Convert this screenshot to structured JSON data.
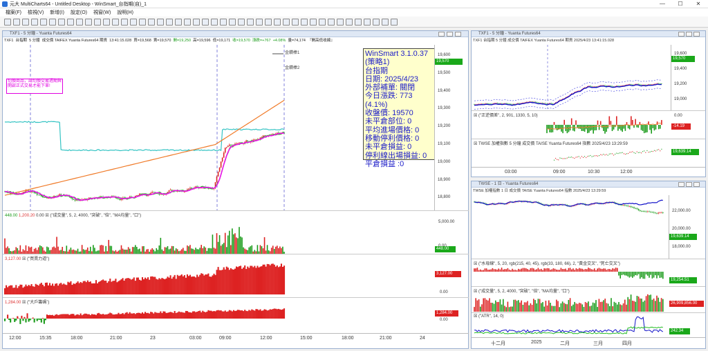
{
  "app": {
    "title": "元大 MultiCharts64 - Untitled Desktop - WinSmart_台指期(自)_1",
    "menu": [
      "檔案(F)",
      "檢視(V)",
      "新增(I)",
      "設定(O)",
      "視窗(W)",
      "說明(H)"
    ],
    "window_controls": [
      "—",
      "☐",
      "✕"
    ]
  },
  "left_window": {
    "title": "TXF1 - 5 分鐘 - Yuanta Futures64",
    "info": {
      "symbol": "TXF1",
      "interval": "5 分鐘",
      "name": "台指期",
      "extra": "成交價  TAIFEX  Yuanta Futures64  期貨",
      "time": "13:41:15.028",
      "buy": "買=19,568",
      "sell": "賣=19,570",
      "open": "開=19,250",
      "high": "高=19,596",
      "low": "低=19,171",
      "close": "收=19,570",
      "change": "漲跌=+767",
      "pct": "+4.08%",
      "volume": "量=74,174",
      "settle": "『開高低收線』"
    },
    "warning": "切換商品，請切換交易週期與開啟正式交易才能下單!",
    "markers": [
      "金鑽棒1",
      "金鑽棒2"
    ],
    "price_axis": [
      "19,600",
      "19,500",
      "19,400",
      "19,300",
      "19,200",
      "19,100",
      "19,000",
      "18,900",
      "18,800"
    ],
    "price_tag": "19,570",
    "infobox": [
      "WinSmart 3.1.0.37",
      "(策略1)",
      "台指期",
      "日期: 2025/4/23",
      "外部補單: 關閉",
      "今日漲跌: 773 (4.1%)",
      "收盤價: 19570",
      "未平倉部位: 0",
      "平均進場價格: 0",
      "移動停利價格: 0",
      "未平倉損益: 0",
      "停利線出場損益: 0",
      "平倉損益 :0"
    ],
    "volume_pane": {
      "vals": [
        "448.00",
        "1,200.20",
        "0.00"
      ],
      "label": "(\"成交量\", 5, 2, 4000, \"突破\", \"倍\", \"MA均量\", \"口\")",
      "axis": [
        "5,000.00",
        "0.00"
      ],
      "tag": "448.00"
    },
    "buysell_pane": {
      "val": "3,127.00",
      "label": "(\"買賣力道\")",
      "axis": [
        "0.00"
      ],
      "tag": "3,127.00"
    },
    "bigplayer_pane": {
      "val": "1,284.00",
      "label": "(\"大戶籌碼\")",
      "axis": [
        "0.00"
      ],
      "tag": "1,284.00"
    },
    "x_axis": [
      "12:00",
      "15:35",
      "18:00",
      "21:00",
      "23",
      "03:00",
      "09:00",
      "12:00",
      "15:00",
      "18:00",
      "21:00",
      "24"
    ]
  },
  "right_top": {
    "title": "TXF1 - 5 分鐘 - Yuanta Futures64",
    "info": "TXF1  台指期  5 分鐘  成交價  TAIFEX  Yuanta Futures64  期貨  2025/4/23  13:41:15.028",
    "price_axis": [
      "19,600",
      "19,400",
      "19,200",
      "19,000"
    ],
    "price_tag": "19,570",
    "sub1": {
      "label": "(\"正逆價差\", 2, 901, 1330, 5, 10)",
      "axis": [
        "0.00"
      ],
      "tag": "-14.19"
    },
    "sub2": {
      "label": "TWSE  加權指數  5 分鐘  成交價  TAISE  Yuanta Futures64  指數  2025/4/23  13:29:59",
      "tag": "19,639.14"
    },
    "x_axis": [
      "03:00",
      "09:00",
      "10:30",
      "12:00"
    ]
  },
  "right_bottom": {
    "title": "TWSE - 1 日 - Yuanta Futures64",
    "info": "TWSE  加權指數  1 日  成交價  TAISE  Yuanta Futures64  指數  2025/4/23  13:29:59",
    "price_axis": [
      "22,000.00",
      "20,000.00",
      "18,000.00"
    ],
    "price_tag": "19,639.14",
    "sub1": {
      "label": "(\"水母線\", 5, 20, rgb(215, 40, 45), rgb(33, 180, 66), 2, \"黃金交叉\", \"死亡交叉\")",
      "tag": "19,254.51"
    },
    "sub2": {
      "label": "(\"成交量\", 5, 2, 4000, \"突破\", \"倍\", \"MA均量\", \"口\")",
      "tag": "26,909,856.00"
    },
    "sub3": {
      "label": "(\"ATR\", 14, 0)",
      "tag": "242.34"
    },
    "x_axis": [
      "十二月",
      "2025",
      "二月",
      "三月",
      "四月"
    ]
  }
}
